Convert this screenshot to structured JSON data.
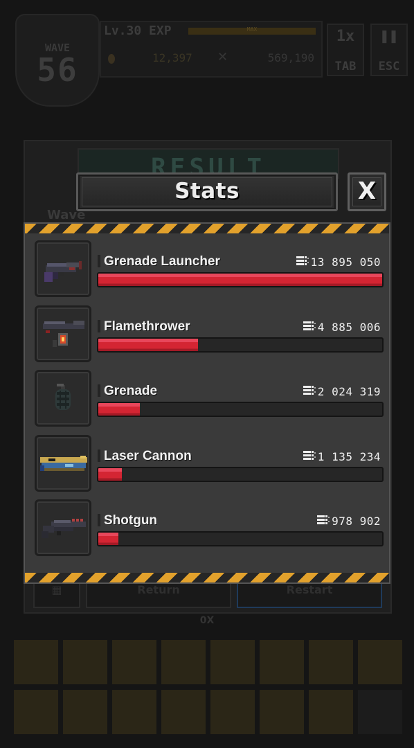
{
  "hud": {
    "wave_label": "WAVE",
    "wave_number": "56",
    "level": "Lv.30",
    "exp_label": "EXP",
    "exp_max": "MAX",
    "gold": "12,397",
    "kills": "569,190",
    "speed_button": "1x",
    "speed_key": "TAB",
    "pause_key": "ESC",
    "result_title": "RESULT",
    "wave_sub": "Wave",
    "return_button": "Return",
    "restart_button": "Restart",
    "speed_multiplier": "0X"
  },
  "stats": {
    "title": "Stats",
    "close_label": "X",
    "weapons": [
      {
        "name": "Grenade Launcher",
        "damage": "13 895 050",
        "fraction": 1.0,
        "icon": "grenade-launcher-icon"
      },
      {
        "name": "Flamethrower",
        "damage": "4 885 006",
        "fraction": 0.352,
        "icon": "flamethrower-icon"
      },
      {
        "name": "Grenade",
        "damage": "2 024 319",
        "fraction": 0.146,
        "icon": "grenade-icon"
      },
      {
        "name": "Laser Cannon",
        "damage": "1 135 234",
        "fraction": 0.082,
        "icon": "laser-cannon-icon"
      },
      {
        "name": "Shotgun",
        "damage": "978 902",
        "fraction": 0.07,
        "icon": "shotgun-icon"
      }
    ]
  },
  "colors": {
    "bar_fill": "#d42533",
    "hazard_yellow": "#e2a12c",
    "panel": "#3a3a3a"
  }
}
